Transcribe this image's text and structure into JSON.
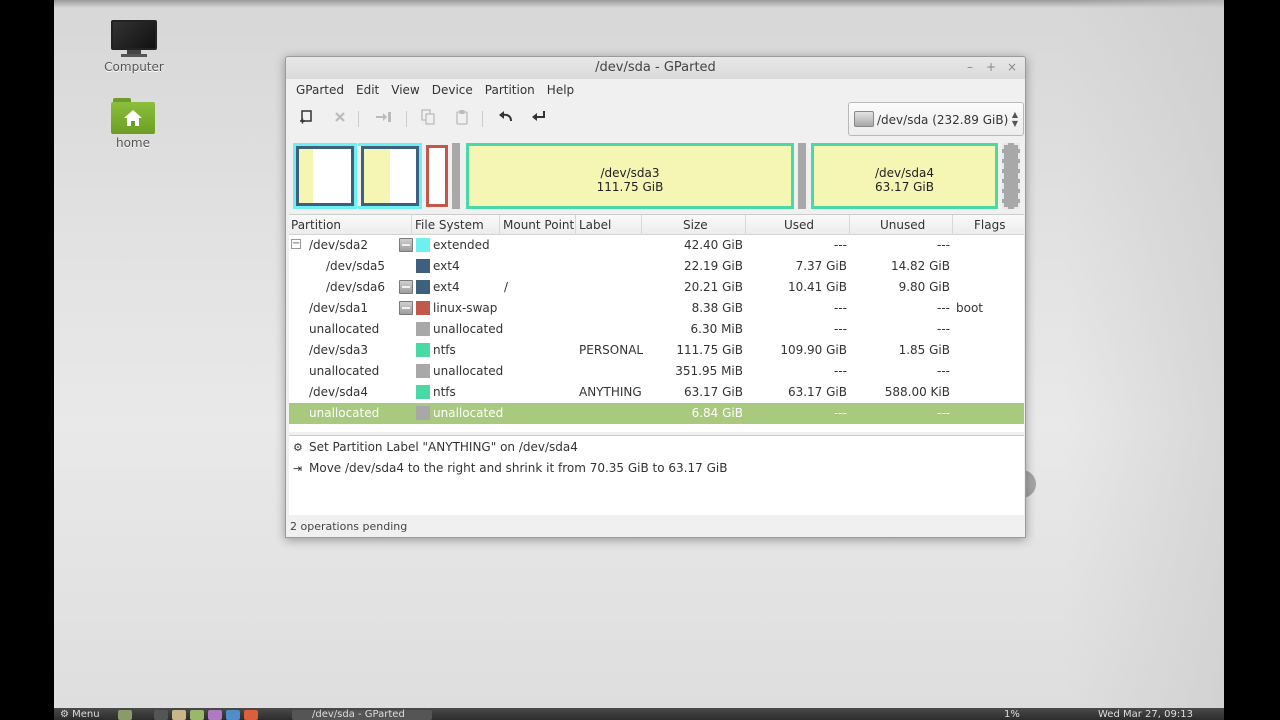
{
  "desktop": {
    "icons": [
      {
        "label": "Computer",
        "icon": "computer-icon"
      },
      {
        "label": "home",
        "icon": "home-folder-icon"
      }
    ]
  },
  "window": {
    "title": "/dev/sda - GParted",
    "controls": {
      "minimize": "–",
      "maximize": "+",
      "close": "×"
    }
  },
  "menu": [
    "GParted",
    "Edit",
    "View",
    "Device",
    "Partition",
    "Help"
  ],
  "toolbar": {
    "new": {
      "icon": "new-partition-icon",
      "enabled": true
    },
    "delete": {
      "icon": "delete-icon",
      "enabled": false
    },
    "resize": {
      "icon": "resize-move-icon",
      "enabled": false
    },
    "copy": {
      "icon": "copy-icon",
      "enabled": false
    },
    "paste": {
      "icon": "paste-icon",
      "enabled": false
    },
    "undo": {
      "icon": "undo-icon",
      "enabled": true
    },
    "apply": {
      "icon": "apply-icon",
      "enabled": true
    }
  },
  "device_selector": {
    "label": "/dev/sda  (232.89 GiB)"
  },
  "disk_map": {
    "segments": [
      {
        "name": "sda5",
        "label": "",
        "size": ""
      },
      {
        "name": "sda6",
        "label": "",
        "size": ""
      },
      {
        "name": "sda1",
        "label": "",
        "size": ""
      },
      {
        "name": "sda3",
        "label": "/dev/sda3",
        "size": "111.75 GiB"
      },
      {
        "name": "sda4",
        "label": "/dev/sda4",
        "size": "63.17 GiB"
      }
    ]
  },
  "colors": {
    "extended": "#6ef0f0",
    "ext4": "#3f5f7f",
    "linux-swap": "#c0594a",
    "unallocated": "#a8a8a8",
    "ntfs": "#4ad8a4",
    "selected_row": "#a9c97e",
    "partition_fill": "#f5f5b4"
  },
  "table": {
    "headers": [
      "Partition",
      "File System",
      "Mount Point",
      "Label",
      "Size",
      "Used",
      "Unused",
      "Flags"
    ],
    "rows": [
      {
        "partition": "/dev/sda2",
        "fs": "extended",
        "mount": "",
        "label": "",
        "size": "42.40 GiB",
        "used": "---",
        "unused": "---",
        "flags": "",
        "color": "#6ef0f0"
      },
      {
        "partition": "/dev/sda5",
        "fs": "ext4",
        "mount": "",
        "label": "",
        "size": "22.19 GiB",
        "used": "7.37 GiB",
        "unused": "14.82 GiB",
        "flags": "",
        "color": "#3f5f7f"
      },
      {
        "partition": "/dev/sda6",
        "fs": "ext4",
        "mount": "/",
        "label": "",
        "size": "20.21 GiB",
        "used": "10.41 GiB",
        "unused": "9.80 GiB",
        "flags": "",
        "color": "#3f5f7f"
      },
      {
        "partition": "/dev/sda1",
        "fs": "linux-swap",
        "mount": "",
        "label": "",
        "size": "8.38 GiB",
        "used": "---",
        "unused": "---",
        "flags": "boot",
        "color": "#c0594a"
      },
      {
        "partition": "unallocated",
        "fs": "unallocated",
        "mount": "",
        "label": "",
        "size": "6.30 MiB",
        "used": "---",
        "unused": "---",
        "flags": "",
        "color": "#a8a8a8"
      },
      {
        "partition": "/dev/sda3",
        "fs": "ntfs",
        "mount": "",
        "label": "PERSONAL",
        "size": "111.75 GiB",
        "used": "109.90 GiB",
        "unused": "1.85 GiB",
        "flags": "",
        "color": "#4ad8a4"
      },
      {
        "partition": "unallocated",
        "fs": "unallocated",
        "mount": "",
        "label": "",
        "size": "351.95 MiB",
        "used": "---",
        "unused": "---",
        "flags": "",
        "color": "#a8a8a8"
      },
      {
        "partition": "/dev/sda4",
        "fs": "ntfs",
        "mount": "",
        "label": "ANYTHING",
        "size": "63.17 GiB",
        "used": "63.17 GiB",
        "unused": "588.00 KiB",
        "flags": "",
        "color": "#4ad8a4"
      },
      {
        "partition": "unallocated",
        "fs": "unallocated",
        "mount": "",
        "label": "",
        "size": "6.84 GiB",
        "used": "---",
        "unused": "---",
        "flags": "",
        "color": "#a8a8a8"
      }
    ]
  },
  "operations": [
    {
      "icon": "gear-icon",
      "text": "Set Partition Label \"ANYTHING\" on /dev/sda4"
    },
    {
      "icon": "move-right-icon",
      "text": "Move /dev/sda4 to the right and shrink it from 70.35 GiB to 63.17 GiB"
    }
  ],
  "status": "2 operations pending",
  "taskbar": {
    "menu_label": "Menu",
    "window_button": "/dev/sda - GParted",
    "battery": "1%",
    "clock": "Wed Mar 27, 09:13"
  }
}
